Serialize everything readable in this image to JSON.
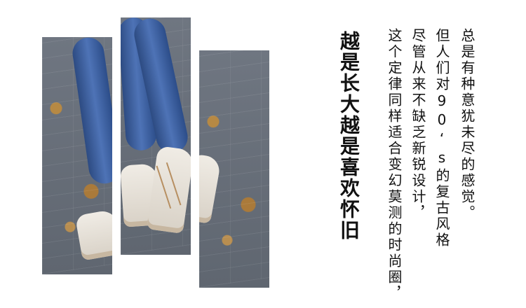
{
  "headline": "越是长大越是喜欢怀旧",
  "paragraph_lines": [
    "这个定律同样适合变幻莫测的时尚圈，",
    "尽管从来不缺乏新锐设计，",
    "但人们对90‘s的复古风格",
    "总是有种意犹未尽的感觉。"
  ]
}
